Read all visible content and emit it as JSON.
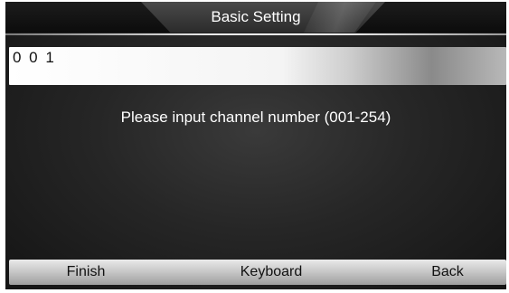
{
  "header": {
    "title": "Basic Setting"
  },
  "input": {
    "value": "0 0 1"
  },
  "main": {
    "prompt": "Please input channel number (001-254)"
  },
  "footer": {
    "finish_label": "Finish",
    "keyboard_label": "Keyboard",
    "back_label": "Back"
  }
}
